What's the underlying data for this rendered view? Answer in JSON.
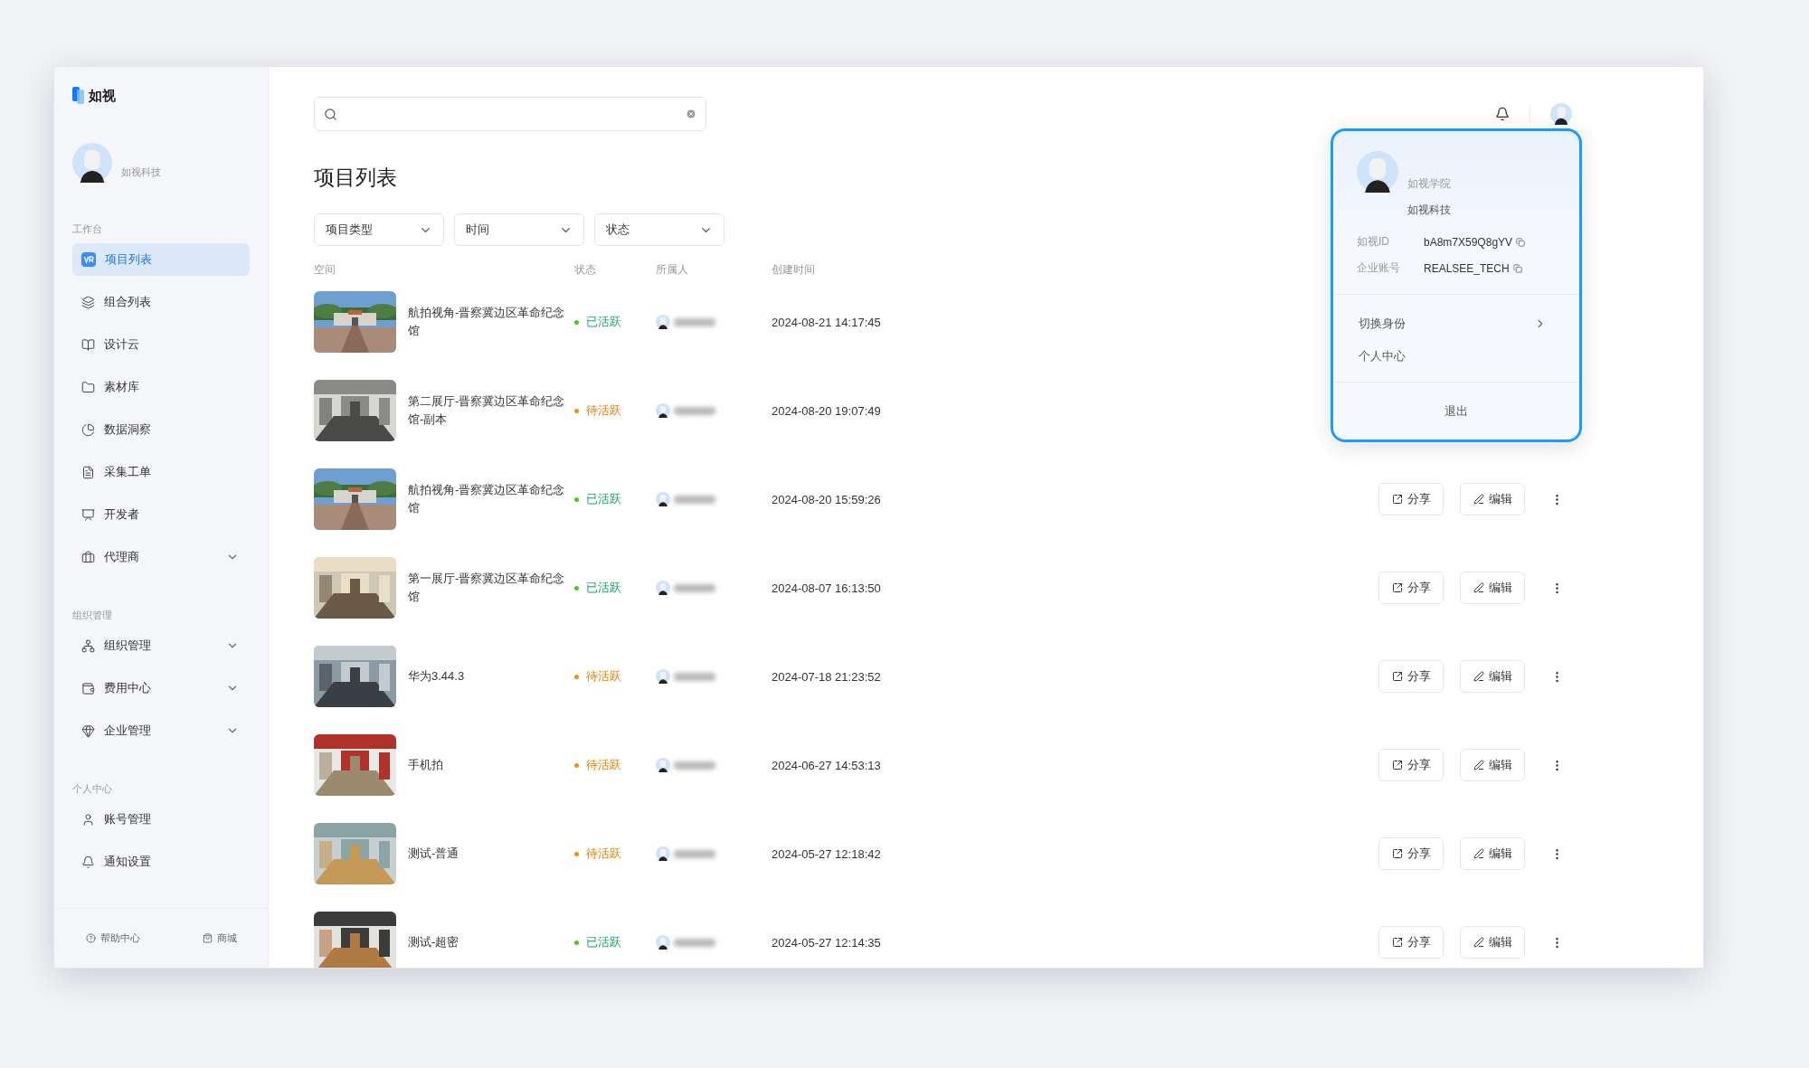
{
  "brand": {
    "name": "如视"
  },
  "sidebar": {
    "profile": {
      "company": "如视科技"
    },
    "sections": [
      {
        "title": "工作台",
        "items": [
          {
            "label": "项目列表",
            "selected": true,
            "expandable": false
          },
          {
            "label": "组合列表",
            "selected": false,
            "expandable": false
          },
          {
            "label": "设计云",
            "selected": false,
            "expandable": false
          },
          {
            "label": "素材库",
            "selected": false,
            "expandable": false
          },
          {
            "label": "数据洞察",
            "selected": false,
            "expandable": false
          },
          {
            "label": "采集工单",
            "selected": false,
            "expandable": false
          },
          {
            "label": "开发者",
            "selected": false,
            "expandable": false
          },
          {
            "label": "代理商",
            "selected": false,
            "expandable": true
          }
        ]
      },
      {
        "title": "组织管理",
        "items": [
          {
            "label": "组织管理",
            "selected": false,
            "expandable": true
          },
          {
            "label": "费用中心",
            "selected": false,
            "expandable": true
          },
          {
            "label": "企业管理",
            "selected": false,
            "expandable": true
          }
        ]
      },
      {
        "title": "个人中心",
        "items": [
          {
            "label": "账号管理",
            "selected": false,
            "expandable": false
          },
          {
            "label": "通知设置",
            "selected": false,
            "expandable": false
          }
        ]
      }
    ],
    "footer": [
      {
        "label": "帮助中心"
      },
      {
        "label": "商城"
      }
    ]
  },
  "page_title": "项目列表",
  "filters": [
    {
      "label": "项目类型"
    },
    {
      "label": "时间"
    },
    {
      "label": "状态"
    }
  ],
  "table": {
    "columns": [
      "空间",
      "状态",
      "所属人",
      "创建时间"
    ],
    "rows": [
      {
        "name": "航拍视角-晋察冀边区革命纪念馆",
        "kind": "active",
        "status": "已活跃",
        "color": "#52c41a",
        "created": "2024-08-21 14:17:45"
      },
      {
        "name": "第二展厅-晋察冀边区革命纪念馆-副本",
        "kind": "pending",
        "status": "待活跃",
        "color": "#fa8c16",
        "created": "2024-08-20 19:07:49"
      },
      {
        "name": "航拍视角-晋察冀边区革命纪念馆",
        "kind": "active",
        "status": "已活跃",
        "color": "#52c41a",
        "created": "2024-08-20 15:59:26",
        "actions": [
          {
            "kind": "share",
            "label": "分享"
          },
          {
            "kind": "edit",
            "label": "编辑"
          }
        ]
      },
      {
        "name": "第一展厅-晋察冀边区革命纪念馆",
        "kind": "active",
        "status": "已活跃",
        "color": "#52c41a",
        "created": "2024-08-07 16:13:50",
        "actions": [
          {
            "kind": "share",
            "label": "分享"
          },
          {
            "kind": "edit",
            "label": "编辑"
          }
        ]
      },
      {
        "name": "华为3.44.3",
        "kind": "pending",
        "status": "待活跃",
        "color": "#fa8c16",
        "created": "2024-07-18 21:23:52",
        "actions": [
          {
            "kind": "share",
            "label": "分享"
          },
          {
            "kind": "edit",
            "label": "编辑"
          }
        ]
      },
      {
        "name": "手机拍",
        "kind": "pending",
        "status": "待活跃",
        "color": "#fa8c16",
        "created": "2024-06-27 14:53:13",
        "actions": [
          {
            "kind": "share",
            "label": "分享"
          },
          {
            "kind": "edit",
            "label": "编辑"
          }
        ]
      },
      {
        "name": "测试-普通",
        "kind": "pending",
        "status": "待活跃",
        "color": "#fa8c16",
        "created": "2024-05-27 12:18:42",
        "actions": [
          {
            "kind": "share",
            "label": "分享"
          },
          {
            "kind": "edit",
            "label": "编辑"
          }
        ]
      },
      {
        "name": "测试-超密",
        "kind": "active",
        "status": "已活跃",
        "color": "#52c41a",
        "created": "2024-05-27 12:14:35",
        "actions": [
          {
            "kind": "share",
            "label": "分享"
          },
          {
            "kind": "edit",
            "label": "编辑"
          }
        ]
      }
    ]
  },
  "user_menu": {
    "name": "如视学院",
    "company": "如视科技",
    "fields": [
      {
        "label": "如视ID",
        "value": "bA8m7X59Q8gYV"
      },
      {
        "label": "企业账号",
        "value": "REALSEE_TECH"
      }
    ],
    "items": [
      {
        "label": "切换身份",
        "submenu": true
      },
      {
        "label": "个人中心",
        "submenu": false
      }
    ],
    "logout": "退出"
  }
}
